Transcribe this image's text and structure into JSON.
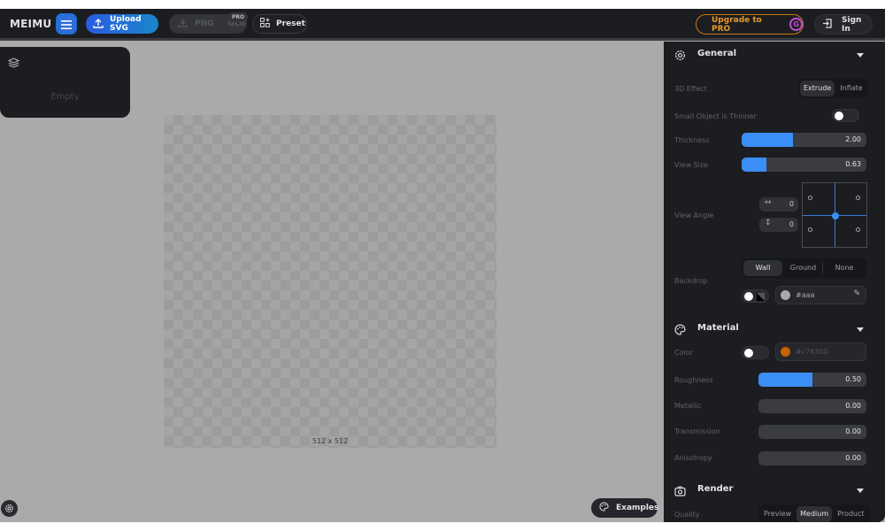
{
  "header": {
    "logo": "MEIMU",
    "upload_label": "Upload SVG",
    "export_png": "PNG",
    "export_glb": "GLB",
    "pro_badge": "PRO",
    "preset_label": "Preset",
    "upgrade_label": "Upgrade to PRO",
    "upgrade_icon_glyph": "G",
    "signin_label": "Sign In"
  },
  "layers": {
    "empty_label": "Empty"
  },
  "canvas": {
    "size_label": "512 x 512"
  },
  "examples_label": "Examples",
  "panel": {
    "general": {
      "title": "General",
      "effect_label": "3D Effect",
      "effect_options": [
        "Extrude",
        "Inflate"
      ],
      "effect_selected": "Extrude",
      "small_thinner_label": "Small Object is Thinner",
      "small_thinner_on": false,
      "thickness_label": "Thickness",
      "thickness_value": "2.00",
      "thickness_fraction": 0.41,
      "view_size_label": "View Size",
      "view_size_value": "0.63",
      "view_size_fraction": 0.2,
      "view_angle_label": "View Angle",
      "view_angle_h": "0",
      "view_angle_v": "0",
      "backdrop_label": "Backdrop",
      "backdrop_options": [
        "Wall",
        "Ground",
        "None"
      ],
      "backdrop_selected": "Wall",
      "backdrop_color": "#aaa"
    },
    "material": {
      "title": "Material",
      "color_label": "Color",
      "color_value": "#c76300",
      "roughness_label": "Roughness",
      "roughness_value": "0.50",
      "roughness_fraction": 0.5,
      "metallic_label": "Metallic",
      "metallic_value": "0.00",
      "transmission_label": "Transmission",
      "transmission_value": "0.00",
      "anisotropy_label": "Anisotropy",
      "anisotropy_value": "0.00"
    },
    "render": {
      "title": "Render",
      "quality_label": "Quality",
      "quality_options": [
        "Preview",
        "Medium",
        "Product"
      ],
      "quality_selected": "Medium"
    }
  },
  "colors": {
    "accent_blue": "#3a8ef5",
    "upgrade_orange": "#e89a2a",
    "pro_purple": "#c04fd8"
  }
}
